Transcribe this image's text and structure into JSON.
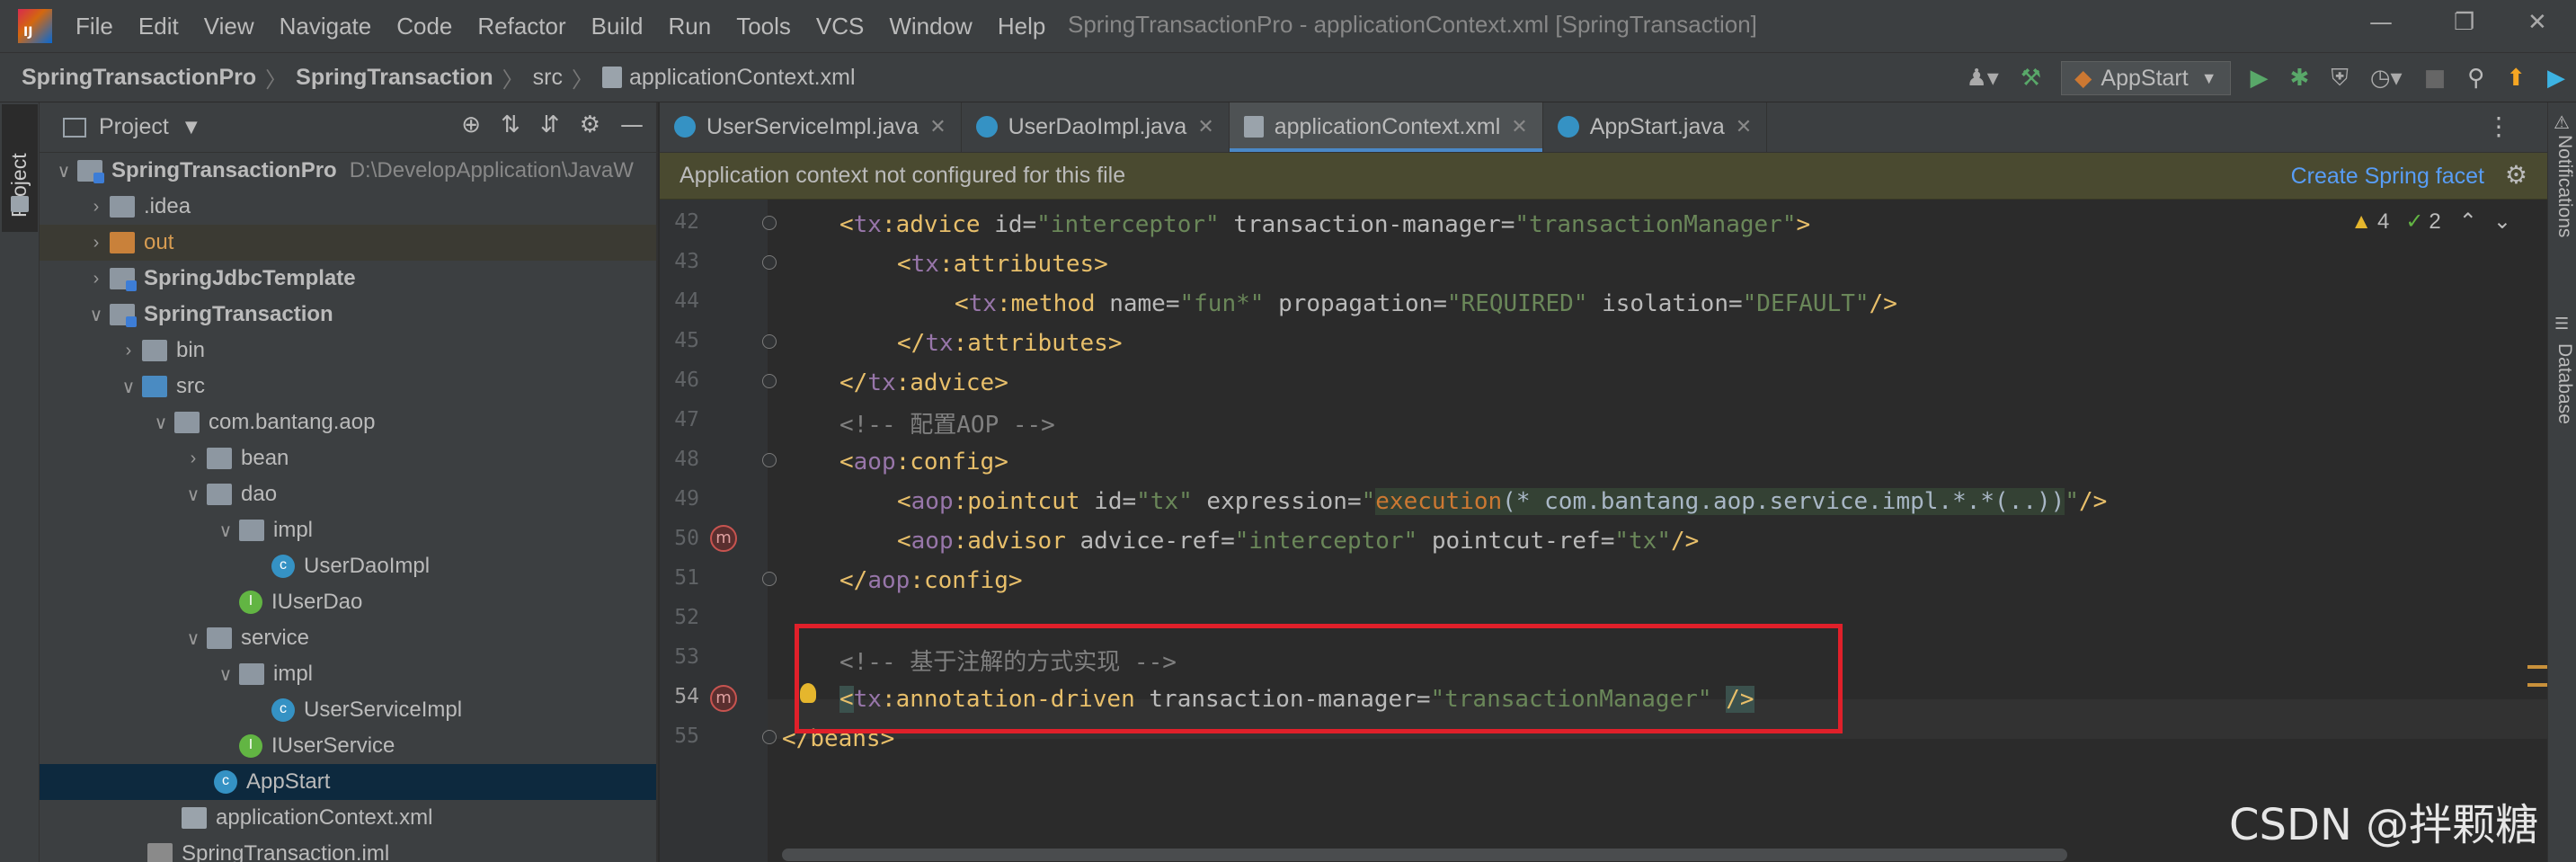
{
  "menubar": {
    "items": [
      "File",
      "Edit",
      "View",
      "Navigate",
      "Code",
      "Refactor",
      "Build",
      "Run",
      "Tools",
      "VCS",
      "Window",
      "Help"
    ],
    "window_title": "SpringTransactionPro - applicationContext.xml [SpringTransaction]"
  },
  "breadcrumb": {
    "items": [
      "SpringTransactionPro",
      "SpringTransaction",
      "src",
      "applicationContext.xml"
    ]
  },
  "toolbar": {
    "run_config": "AppStart"
  },
  "left_stripe": {
    "project_label": "Project"
  },
  "project_panel": {
    "title": "Project",
    "tree": [
      {
        "label": "SpringTransactionPro",
        "path": "D:\\DevelopApplication\\JavaW"
      },
      {
        "label": ".idea"
      },
      {
        "label": "out"
      },
      {
        "label": "SpringJdbcTemplate"
      },
      {
        "label": "SpringTransaction"
      },
      {
        "label": "bin"
      },
      {
        "label": "src"
      },
      {
        "label": "com.bantang.aop"
      },
      {
        "label": "bean"
      },
      {
        "label": "dao"
      },
      {
        "label": "impl"
      },
      {
        "label": "UserDaoImpl"
      },
      {
        "label": "IUserDao"
      },
      {
        "label": "service"
      },
      {
        "label": "impl"
      },
      {
        "label": "UserServiceImpl"
      },
      {
        "label": "IUserService"
      },
      {
        "label": "AppStart"
      },
      {
        "label": "applicationContext.xml"
      },
      {
        "label": "SpringTransaction.iml"
      }
    ]
  },
  "editor": {
    "tabs": [
      {
        "label": "UserServiceImpl.java"
      },
      {
        "label": "UserDaoImpl.java"
      },
      {
        "label": "applicationContext.xml"
      },
      {
        "label": "AppStart.java"
      }
    ],
    "banner": {
      "text": "Application context not configured for this file",
      "link": "Create Spring facet"
    },
    "inspections": {
      "warnings": "4",
      "weak_warnings": "2"
    },
    "line_numbers": [
      "42",
      "43",
      "44",
      "45",
      "46",
      "47",
      "48",
      "49",
      "50",
      "51",
      "52",
      "53",
      "54",
      "55"
    ],
    "code": {
      "l42": {
        "ns": "tx",
        "tag": "advice",
        "a1": "id",
        "v1": "\"interceptor\"",
        "a2": "transaction-manager",
        "v2": "\"transactionManager\""
      },
      "l43": {
        "ns": "tx",
        "tag": "attributes"
      },
      "l44": {
        "ns": "tx",
        "tag": "method",
        "a1": "name",
        "v1": "\"fun*\"",
        "a2": "propagation",
        "v2": "\"REQUIRED\"",
        "a3": "isolation",
        "v3": "\"DEFAULT\""
      },
      "l45": {
        "ns": "tx",
        "tag": "attributes"
      },
      "l46": {
        "ns": "tx",
        "tag": "advice"
      },
      "l47": {
        "comment": "<!-- 配置AOP -->"
      },
      "l48": {
        "ns": "aop",
        "tag": "config"
      },
      "l49": {
        "ns": "aop",
        "tag": "pointcut",
        "a1": "id",
        "v1": "\"tx\"",
        "a2": "expression",
        "fn": "execution",
        "expr": "(* com.bantang.aop.service.impl.*.*(..))"
      },
      "l50": {
        "ns": "aop",
        "tag": "advisor",
        "a1": "advice-ref",
        "v1": "\"interceptor\"",
        "a2": "pointcut-ref",
        "v2": "\"tx\""
      },
      "l51": {
        "ns": "aop",
        "tag": "config"
      },
      "l53": {
        "comment": "<!-- 基于注解的方式实现 -->"
      },
      "l54": {
        "ns": "tx",
        "tag": "annotation-driven",
        "a1": "transaction-manager",
        "v1": "\"transactionManager\""
      },
      "l55": {
        "tag": "beans"
      }
    }
  },
  "right_stripe": {
    "notifications": "Notifications",
    "database": "Database"
  },
  "watermark": "CSDN @拌颗糖",
  "colors": {
    "accent": "#4a88c7",
    "highlight_box": "#e0202a",
    "link": "#589df6"
  }
}
